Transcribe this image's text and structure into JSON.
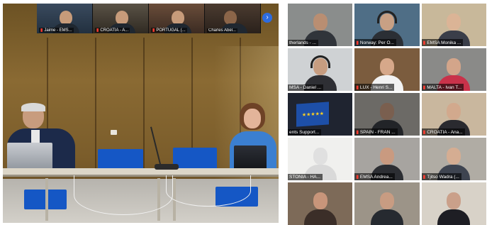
{
  "speaker_view": {
    "thumbnails": [
      {
        "label": "Jaime - EMS..."
      },
      {
        "label": "CROATIA - A..."
      },
      {
        "label": "PORTUGAL (..."
      },
      {
        "label": "Charles Abel..."
      }
    ],
    "next_icon": "chevron-right-icon"
  },
  "gallery": {
    "tiles": [
      {
        "label": "therlands - ...",
        "bg": "#8a8d8c",
        "face": "#b98e72",
        "body": "#30343a"
      },
      {
        "label": "Norway: Per O...",
        "bg": "#4f6e86",
        "face": "#c8a084",
        "body": "#2b2f35"
      },
      {
        "label": "EMSA Monika ...",
        "bg": "#c8b89a",
        "face": "#dbb496",
        "body": "#3a3e49"
      },
      {
        "label": "MSA - Daniel ...",
        "bg": "#cfd2d4",
        "face": "#c79d80",
        "body": "#2e2f34"
      },
      {
        "label": "LUX - Henri S...",
        "bg": "#7b5c3e",
        "face": "#d6a88a",
        "body": "#f2f2f2"
      },
      {
        "label": "MALTA - Ivan T...",
        "bg": "#8a8a88",
        "face": "#d3a58a",
        "body": "#c9324a"
      },
      {
        "label": "ents Support...",
        "bg": "#1f2430",
        "face": "#1f2430",
        "body": "#1f2430"
      },
      {
        "label": "SPAIN - FRAN ...",
        "bg": "#6c6a66",
        "face": "#7a5f4f",
        "body": "#222428"
      },
      {
        "label": "CROATIA - Ana...",
        "bg": "#c9b79e",
        "face": "#d2a98d",
        "body": "#2a2a2f"
      },
      {
        "label": "STONIA - HA...",
        "bg": "#f0f0ee",
        "face": "#e0e0e0",
        "body": "#d9d9d9"
      },
      {
        "label": "EMSA Andrea...",
        "bg": "#a7a4a0",
        "face": "#c99a80",
        "body": "#2c2e33"
      },
      {
        "label": "Tjitso Wadra (...",
        "bg": "#b0aca4",
        "face": "#d5ad92",
        "body": "#3e4450"
      },
      {
        "label": "",
        "bg": "#7d6a58",
        "face": "#c8957a",
        "body": "#3b2e28"
      },
      {
        "label": "",
        "bg": "#9c9488",
        "face": "#c89c82",
        "body": "#262a30"
      },
      {
        "label": "",
        "bg": "#d8d2c8",
        "face": "#caa08a",
        "body": "#1e1e24"
      }
    ],
    "eu_flag_stars": "★ ★ ★ ★ ★"
  },
  "colors": {
    "mute_icon": "#ff3b30",
    "accent_button": "#2d6cdf",
    "chair": "#1557c5"
  }
}
